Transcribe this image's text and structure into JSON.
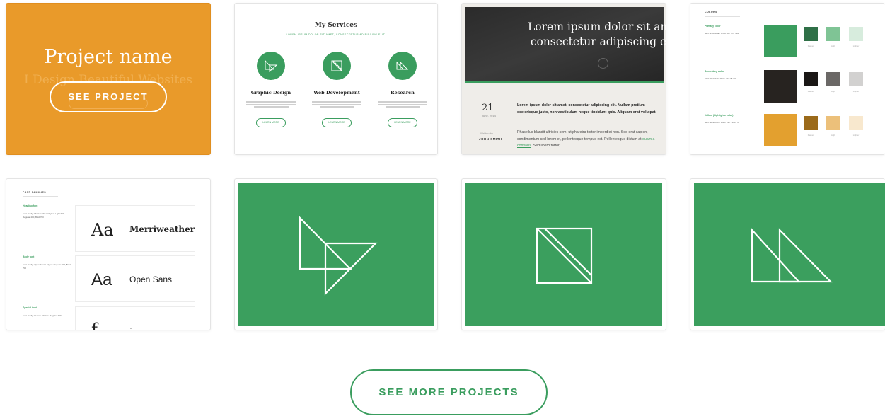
{
  "colors": {
    "green": "#3a9d5e",
    "orange": "#e99a2a",
    "dark": "#272320"
  },
  "card1": {
    "faded_subtitle": "I Design Beautiful Websites",
    "project_name": "Project name",
    "button": "SEE PROJECT"
  },
  "services": {
    "title": "My Services",
    "subtitle": "LOREM IPSUM DOLOR SIT AMET, CONSECTETUR ADIPISCING ELIT.",
    "items": [
      {
        "name": "Graphic Design",
        "button": "LEARN MORE",
        "icon": "graphic-design-icon"
      },
      {
        "name": "Web Development",
        "button": "LEARN MORE",
        "icon": "web-development-icon"
      },
      {
        "name": "Research",
        "button": "LEARN MORE",
        "icon": "research-icon"
      }
    ]
  },
  "blog": {
    "heading_line1": "Lorem ipsum dolor sit am",
    "heading_line2": "consectetur adipiscing e",
    "day": "21",
    "month": "June, 2014",
    "written_by": "Written by",
    "author": "JOHN SMITH",
    "lead": "Lorem ipsum dolor sit amet, consectetur adipiscing elit. Nullam pretium scelerisque justo, non vestibulum neque tincidunt quis. Aliquam erat volutpat.",
    "body_before_link": "Phasellus blandit ultricies sem, ut pharetra tortor imperdiet non. Sed erat sapien, condimentum sed lorem et, pellentesque tempus est. Pellentesque dictum at ",
    "body_link": "quam a convallis",
    "body_after_link": ". Sed libero tortor,"
  },
  "colors_card": {
    "header": "COLORS",
    "rows": [
      {
        "label": "Primary color",
        "spec": "HEX: #3A9D5E / RGB: 58 / 157 / 94",
        "main": "#3a9d5e",
        "swatches": [
          "#2f7047",
          "#7fc495",
          "#d7ecdd"
        ]
      },
      {
        "label": "Secondary color",
        "spec": "HEX: #272320 / RGB: 39 / 35 / 32",
        "main": "#272320",
        "swatches": [
          "#1a1715",
          "#6b6866",
          "#d2d1d0"
        ]
      },
      {
        "label": "Yellow (highlights color)",
        "spec": "HEX: #E3A02F / RGB: 227 / 160 / 47",
        "main": "#e3a02f",
        "swatches": [
          "#9b6a1a",
          "#ecc07a",
          "#f8e8ce"
        ]
      }
    ],
    "swatch_labels": [
      "Darker",
      "Light",
      "Lighter"
    ]
  },
  "fonts_card": {
    "header": "FONT FAMILIES",
    "sections": [
      {
        "label": "Heading font",
        "spec": "Font family: Merriweather / Styles: Light 300, Regular 400, Bold 700"
      },
      {
        "label": "Body font",
        "spec": "Font family: Open Sans / Styles: Regular 400, Bold 700"
      },
      {
        "label": "Special font",
        "spec": "Font family: Vernon / Styles: Regular 400"
      }
    ],
    "samples": [
      {
        "aa": "Aa",
        "name": "Merriweather"
      },
      {
        "aa": "Aa",
        "name": "Open Sans"
      },
      {
        "aa": "ƒ",
        "name": "·"
      }
    ]
  },
  "cta": "SEE MORE PROJECTS"
}
